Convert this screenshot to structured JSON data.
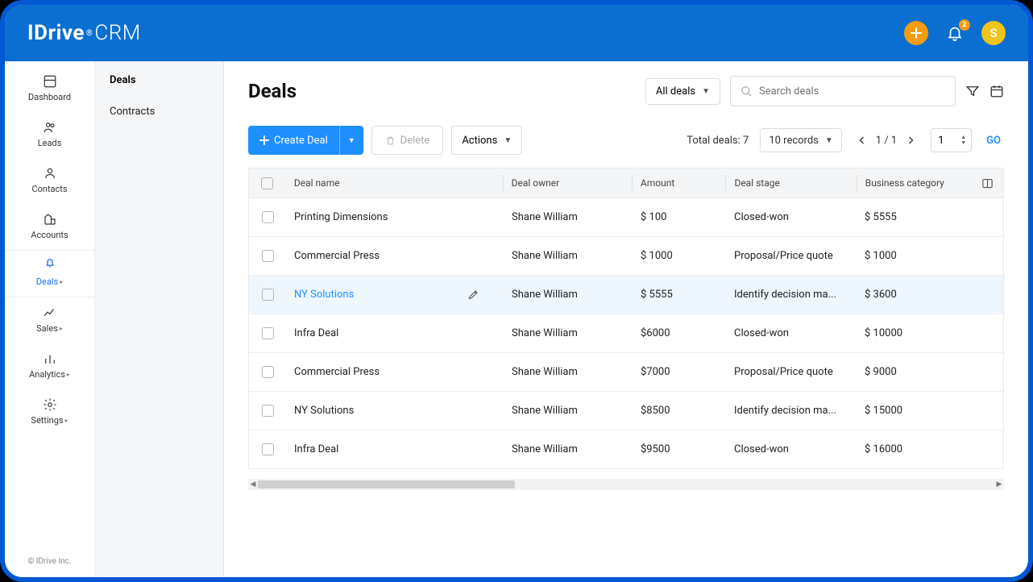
{
  "brand": {
    "name": "IDrive",
    "suffix": "CRM",
    "registered": "®"
  },
  "top": {
    "notif_count": "2",
    "avatar_initial": "S"
  },
  "rail": {
    "items": [
      {
        "key": "dashboard",
        "label": "Dashboard",
        "has_caret": false
      },
      {
        "key": "leads",
        "label": "Leads",
        "has_caret": false
      },
      {
        "key": "contacts",
        "label": "Contacts",
        "has_caret": false
      },
      {
        "key": "accounts",
        "label": "Accounts",
        "has_caret": false
      },
      {
        "key": "deals",
        "label": "Deals",
        "has_caret": true,
        "active": true
      },
      {
        "key": "sales",
        "label": "Sales",
        "has_caret": true
      },
      {
        "key": "analytics",
        "label": "Analytics",
        "has_caret": true
      },
      {
        "key": "settings",
        "label": "Settings",
        "has_caret": true
      }
    ],
    "copyright": "© IDrive Inc."
  },
  "subnav": {
    "items": [
      {
        "label": "Deals",
        "active": true
      },
      {
        "label": "Contracts",
        "active": false
      }
    ]
  },
  "page": {
    "title": "Deals",
    "filter_label": "All deals",
    "search_placeholder": "Search deals"
  },
  "toolbar": {
    "create_label": "Create Deal",
    "delete_label": "Delete",
    "actions_label": "Actions",
    "total_label": "Total deals: 7",
    "page_size_label": "10 records",
    "page_indicator": "1 / 1",
    "page_input_value": "1",
    "go_label": "GO"
  },
  "table": {
    "columns": {
      "name": "Deal name",
      "owner": "Deal owner",
      "amount": "Amount",
      "stage": "Deal stage",
      "category": "Business category"
    },
    "rows": [
      {
        "name": "Printing Dimensions",
        "owner": "Shane William",
        "amount": "$ 100",
        "stage": "Closed-won",
        "category": "$ 5555"
      },
      {
        "name": "Commercial Press",
        "owner": "Shane William",
        "amount": "$ 1000",
        "stage": "Proposal/Price quote",
        "category": "$ 1000"
      },
      {
        "name": "NY Solutions",
        "owner": "Shane William",
        "amount": "$ 5555",
        "stage": "Identify decision ma...",
        "category": "$ 3600",
        "hover": true
      },
      {
        "name": "Infra Deal",
        "owner": "Shane William",
        "amount": "$6000",
        "stage": "Closed-won",
        "category": "$ 10000"
      },
      {
        "name": "Commercial Press",
        "owner": "Shane William",
        "amount": "$7000",
        "stage": "Proposal/Price quote",
        "category": "$ 9000"
      },
      {
        "name": "NY Solutions",
        "owner": "Shane William",
        "amount": "$8500",
        "stage": "Identify decision ma...",
        "category": "$ 15000"
      },
      {
        "name": "Infra Deal",
        "owner": "Shane William",
        "amount": "$9500",
        "stage": "Closed-won",
        "category": "$ 16000"
      }
    ]
  }
}
